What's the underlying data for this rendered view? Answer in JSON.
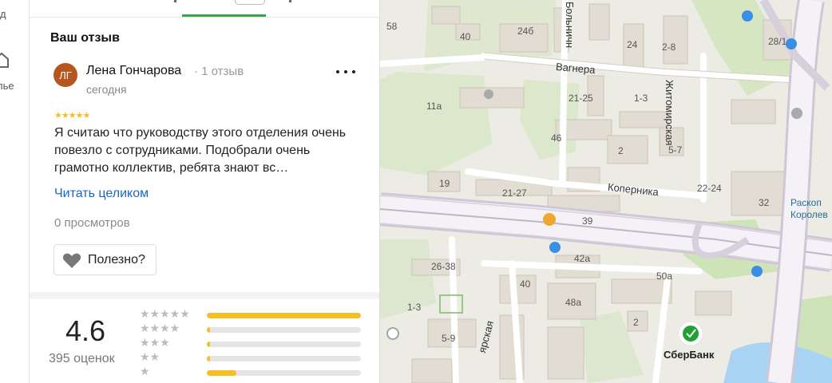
{
  "sidebar": {
    "text_top": "д",
    "text_mid": "лье"
  },
  "review_section": {
    "title": "Ваш отзыв"
  },
  "review": {
    "avatar_initials": "ЛГ",
    "author_name": "Лена Гончарова",
    "author_meta": "· 1 отзыв",
    "date": "сегодня",
    "stars": "★★★★★",
    "rating": 5,
    "text": "Я считаю что руководству этого отделения очень повезло с сотрудниками. Подобрали очень грамотно коллектив, ребята знают вс…",
    "read_more": "Читать целиком",
    "views": "0 просмотров",
    "helpful_label": "Полезно?"
  },
  "summary": {
    "rating": "4.6",
    "count": "395 оценок",
    "distribution": [
      {
        "stars": "★★★★★",
        "fraction": 1.0
      },
      {
        "stars": "★★★★",
        "fraction": 0.02
      },
      {
        "stars": "★★★",
        "fraction": 0.02
      },
      {
        "stars": "★★",
        "fraction": 0.02
      },
      {
        "stars": "★",
        "fraction": 0.19
      }
    ]
  },
  "map": {
    "streets": {
      "vagnera": "Вагнера",
      "kopernika": "Коперника",
      "zhitomirskaya": "Житомирская",
      "bolnichnaya": "Больничн",
      "yarskaya": "ярская"
    },
    "poi": {
      "raskop_line1": "Раскоп",
      "raskop_line2": "Королев",
      "sberbank": "СберБанк"
    },
    "house_numbers": {
      "n58": "58",
      "n40a": "40",
      "n24b": "24б",
      "n24": "24",
      "n28": "2-8",
      "n28_1": "28/1",
      "n11a": "11а",
      "n21_25": "21-25",
      "n1_3a": "1-3",
      "n46": "46",
      "n2a": "2",
      "n5_7": "5-7",
      "n19": "19",
      "n21_27": "21-27",
      "n22_24": "22-24",
      "n32": "32",
      "n39": "39",
      "n42a": "42а",
      "n26_38": "26-38",
      "n40b": "40",
      "n50a": "50а",
      "n1_3b": "1-3",
      "n48a": "48а",
      "n2b": "2",
      "n5_9": "5-9"
    }
  },
  "colors": {
    "accent_green": "#3aa44a",
    "star_yellow": "#f6bd25",
    "link_blue": "#1a67c2",
    "avatar_bg": "#b5561f"
  }
}
